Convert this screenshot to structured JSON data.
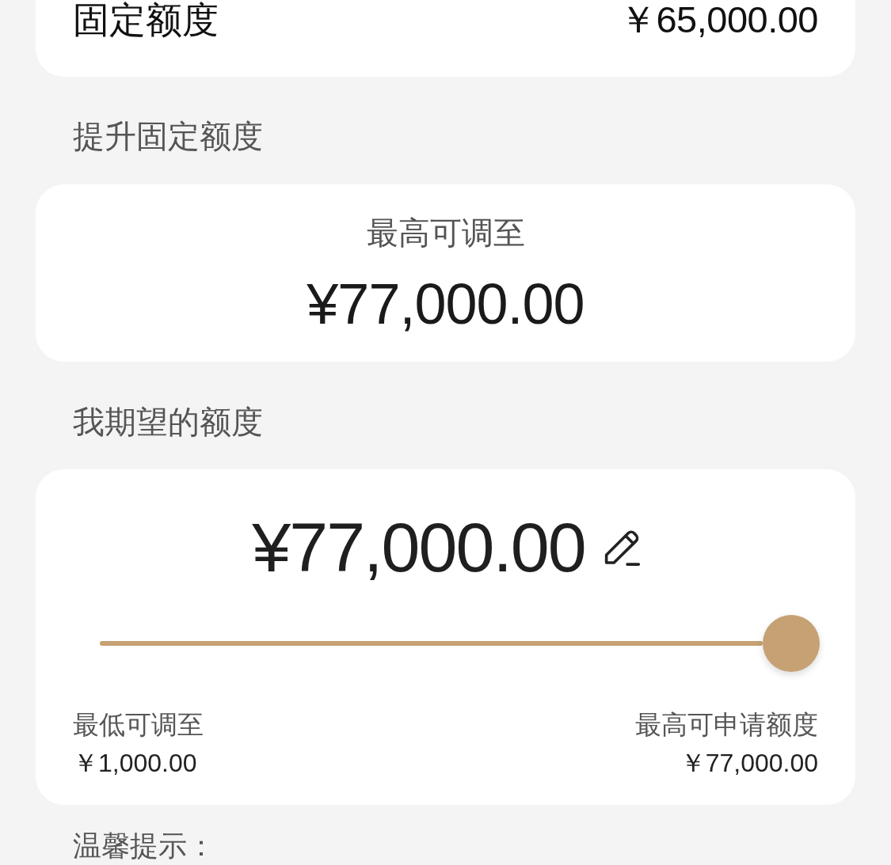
{
  "fixed_quota": {
    "label": "固定额度",
    "amount": "￥65,000.00"
  },
  "raise_section": {
    "title": "提升固定额度",
    "caption": "最高可调至",
    "amount": "¥77,000.00"
  },
  "expected_section": {
    "title": "我期望的额度",
    "amount": "¥77,000.00",
    "slider": {
      "level": 1
    },
    "min": {
      "label": "最低可调至",
      "amount": "￥1,000.00"
    },
    "max": {
      "label": "最高可申请额度",
      "amount": "￥77,000.00"
    }
  },
  "tips": {
    "title": "温馨提示："
  }
}
